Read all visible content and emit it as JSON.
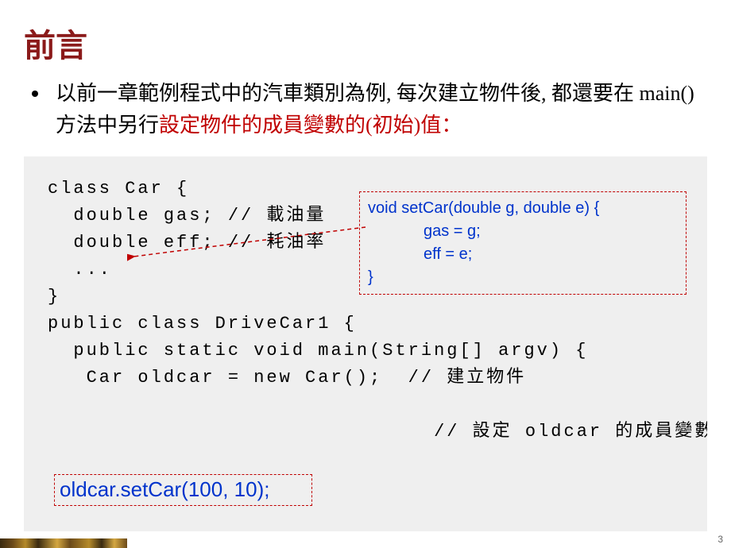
{
  "title": "前言",
  "bullet": {
    "pre": "以前一章範例程式中的汽車類別為例, 每次建立物件後, 都還要在 main() 方法中另行",
    "hl": "設定物件的成員變數的(初始)值：",
    "post": ""
  },
  "code": {
    "l1": "class Car {",
    "l2": "  double gas; // 載油量",
    "l3": "  double eff; // 耗油率",
    "l4": "  ...",
    "l5": "}",
    "l6": "",
    "l7": "public class DriveCar1 {",
    "l8": "  public static void main(String[] argv) {",
    "l9": "   Car oldcar = new Car();  // 建立物件",
    "l10": "",
    "l11_tail": "// 設定 oldcar 的成員變數值",
    "l12": "    ..."
  },
  "callout_method": {
    "sig": "void setCar(double g, double e) {",
    "body1": "gas = g;",
    "body2": "eff = e;",
    "close": "}"
  },
  "callout_call": "oldcar.setCar(100, 10);",
  "page_number": "3"
}
